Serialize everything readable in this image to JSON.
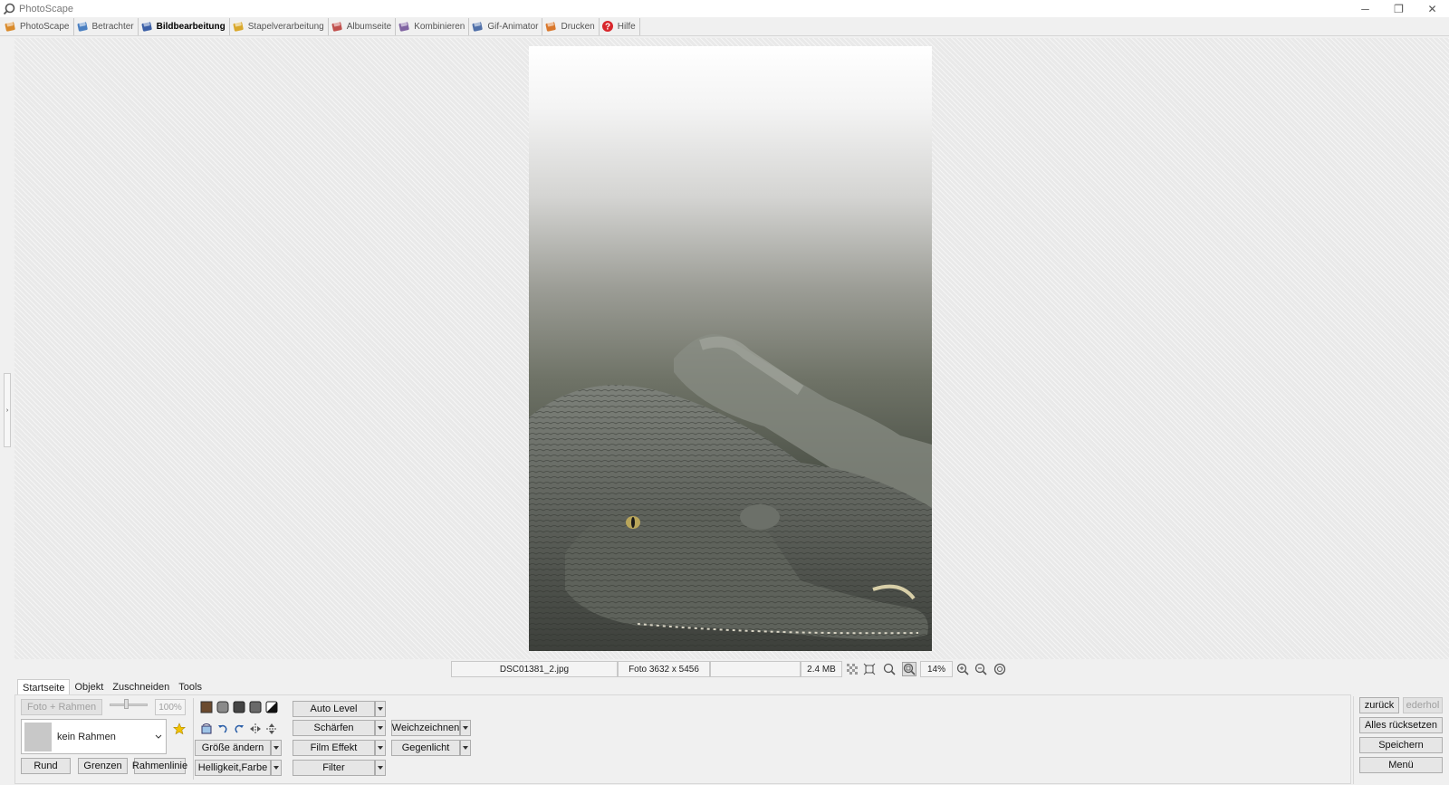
{
  "window": {
    "title": "PhotoScape",
    "minimize_glyph": "─",
    "restore_glyph": "❐",
    "close_glyph": "✕"
  },
  "tabs": [
    {
      "label": "PhotoScape",
      "icon": "photoscape-icon",
      "color": "#d98a2b"
    },
    {
      "label": "Betrachter",
      "icon": "viewer-icon",
      "color": "#4a7fc1"
    },
    {
      "label": "Bildbearbeitung",
      "icon": "editor-icon",
      "color": "#3b5fa6",
      "active": true
    },
    {
      "label": "Stapelverarbeitung",
      "icon": "batch-icon",
      "color": "#d9a82b"
    },
    {
      "label": "Albumseite",
      "icon": "page-icon",
      "color": "#c0504d"
    },
    {
      "label": "Kombinieren",
      "icon": "combine-icon",
      "color": "#8064a2"
    },
    {
      "label": "Gif-Animator",
      "icon": "gif-icon",
      "color": "#4f6fa8"
    },
    {
      "label": "Drucken",
      "icon": "print-icon",
      "color": "#d9772b"
    },
    {
      "label": "Hilfe",
      "icon": "help-icon",
      "color": "#d8262b"
    }
  ],
  "left_handle_glyph": "›",
  "status": {
    "filename": "DSC01381_2.jpg",
    "dimensions": "Foto 3632 x 5456",
    "empty": "",
    "filesize": "2.4 MB",
    "zoom": "14%"
  },
  "bottom_tabs": [
    {
      "label": "Startseite",
      "active": true
    },
    {
      "label": "Objekt"
    },
    {
      "label": "Zuschneiden"
    },
    {
      "label": "Tools"
    }
  ],
  "frame": {
    "photo_frame_button": "Foto + Rahmen",
    "opacity": "100%",
    "frame_select": "kein Rahmen",
    "round_button": "Rund",
    "borders_button": "Grenzen",
    "frameline_button": "Rahmenlinie"
  },
  "tools": {
    "resize": "Größe ändern",
    "brightness": "Helligkeit,Farbe",
    "auto_level": "Auto Level",
    "sharpen": "Schärfen",
    "film_effect": "Film Effekt",
    "filter": "Filter",
    "blur": "Weichzeichnen",
    "backlight": "Gegenlicht"
  },
  "actions": {
    "undo": "zurück",
    "redo": "ederhol",
    "reset_all": "Alles rücksetzen",
    "save": "Speichern",
    "menu": "Menü"
  },
  "colors": {
    "help_red": "#d8262b",
    "star_yellow": "#f2c200",
    "canvas_bg": "#e9e9e9"
  }
}
